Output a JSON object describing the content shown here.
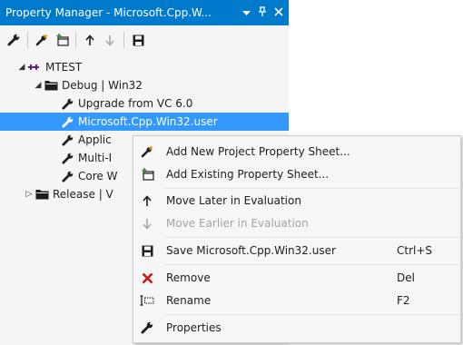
{
  "window": {
    "title": "Property Manager - Microsoft.Cpp.W...",
    "dropdown_icon": "chevron-down-icon",
    "pin_icon": "pin-icon",
    "close_icon": "close-icon"
  },
  "toolbar": {
    "buttons": [
      {
        "icon": "wrench-icon",
        "enabled": true
      },
      {
        "icon": "add-new-sheet-icon",
        "enabled": true
      },
      {
        "icon": "add-existing-sheet-icon",
        "enabled": true
      },
      {
        "icon": "arrow-up-icon",
        "enabled": true
      },
      {
        "icon": "arrow-down-icon",
        "enabled": false
      },
      {
        "icon": "save-icon",
        "enabled": true
      }
    ]
  },
  "tree": {
    "project": "MTEST",
    "config_debug": "Debug | Win32",
    "item_upgrade": "Upgrade from VC 6.0",
    "item_user": "Microsoft.Cpp.Win32.user",
    "item_applic": "Applic",
    "item_multi": "Multi-I",
    "item_core": "Core W",
    "config_release": "Release | V"
  },
  "context_menu": {
    "add_new": "Add New Project Property Sheet...",
    "add_existing": "Add Existing Property Sheet...",
    "move_later": "Move Later in Evaluation",
    "move_earlier": "Move Earlier in Evaluation",
    "save": "Save Microsoft.Cpp.Win32.user",
    "save_key": "Ctrl+S",
    "remove": "Remove",
    "remove_key": "Del",
    "rename": "Rename",
    "rename_key": "F2",
    "properties": "Properties"
  },
  "colors": {
    "title_bg": "#007acc",
    "selection_bg": "#3399ff",
    "remove_icon": "#c5171b"
  }
}
